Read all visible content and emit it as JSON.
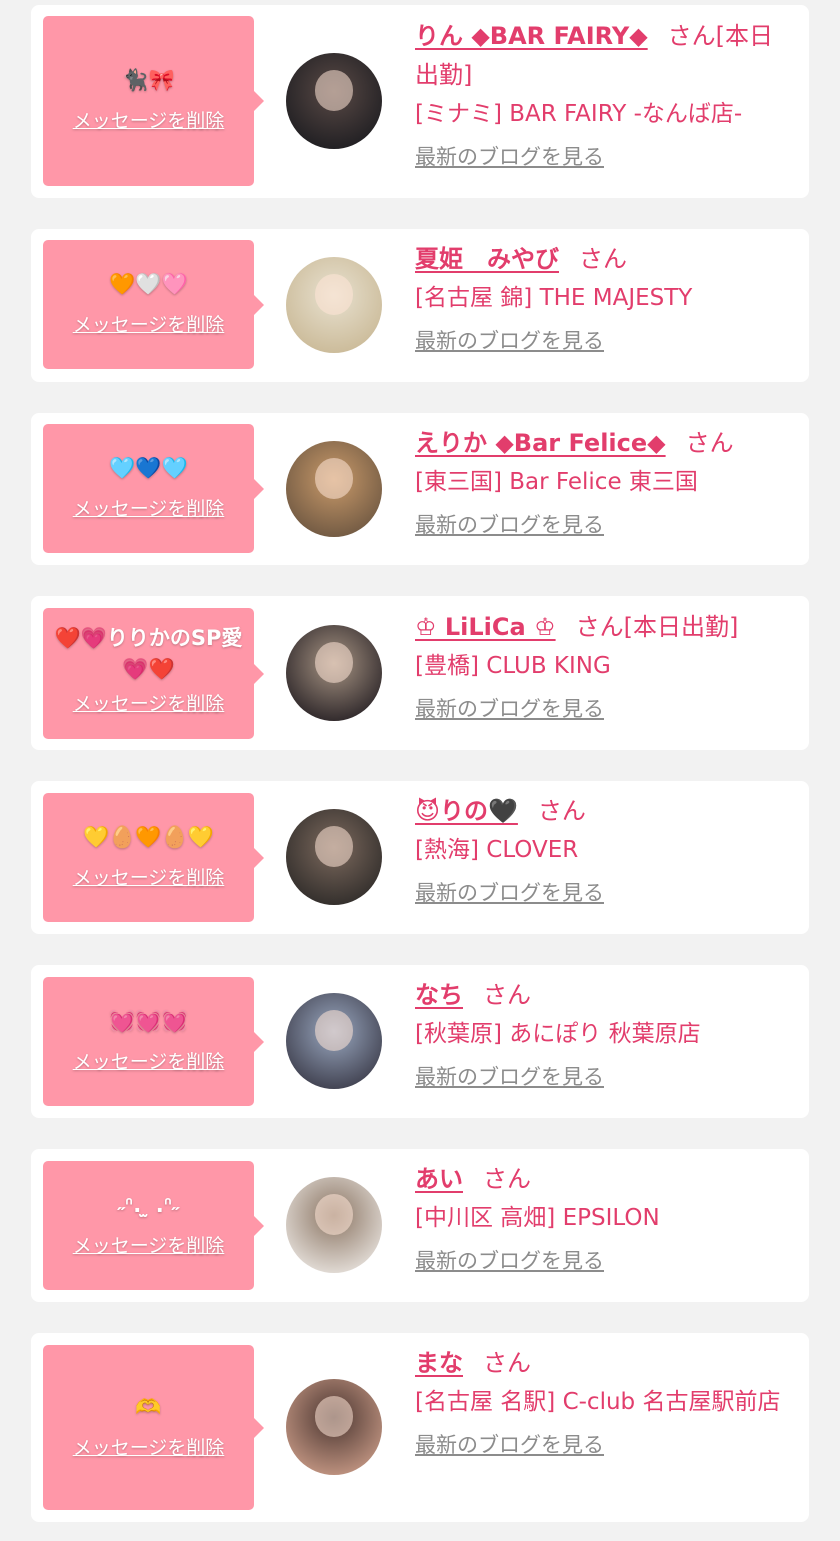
{
  "delete_label": "メッセージを削除",
  "blog_label": "最新のブログを見る",
  "honorific": "さん",
  "colors": {
    "background": "#f2f2f2",
    "card": "#ffffff",
    "message_bubble": "#ff97a8",
    "accent": "#e23d6c",
    "link_gray": "#8c8c8c"
  },
  "cards": [
    {
      "message": "🐈‍⬛🎀",
      "name": "りん ◆BAR FAIRY◆",
      "status": "[本日出勤]",
      "shop": "[ミナミ] BAR FAIRY -なんば店-",
      "avatar_colors": [
        "#1c1c20",
        "#5a4a46"
      ]
    },
    {
      "message": "🧡🤍🩷",
      "name": "夏姫　みやび",
      "status": "",
      "shop": "[名古屋 錦] THE MAJESTY",
      "avatar_colors": [
        "#c9b895",
        "#e8e1d0"
      ]
    },
    {
      "message": "🩵💙🩵",
      "name": "えりか ◆Bar Felice◆",
      "status": "",
      "shop": "[東三国] Bar Felice 東三国",
      "avatar_colors": [
        "#6b5540",
        "#c99a6a"
      ]
    },
    {
      "message": "❤️💗りりかのSP愛💗❤️",
      "name": "♔ LiLiCa ♔",
      "status": "[本日出勤]",
      "shop": "[豊橋] CLUB KING",
      "avatar_colors": [
        "#262024",
        "#a89584"
      ]
    },
    {
      "message": "💛🥚🧡🥚💛",
      "name": "😈りの🖤",
      "status": "",
      "shop": "[熱海] CLOVER",
      "avatar_colors": [
        "#2d2a28",
        "#7d6a5e"
      ]
    },
    {
      "message": "💓💓💓",
      "name": "なち",
      "status": "",
      "shop": "[秋葉原] あにぽり 秋葉原店",
      "avatar_colors": [
        "#3a3a48",
        "#9aa8c0"
      ]
    },
    {
      "message": "˶ᐢ. ̫ .ᐢ˶",
      "name": "あい",
      "status": "",
      "shop": "[中川区 高畑] EPSILON",
      "avatar_colors": [
        "#e9e4df",
        "#8a7462"
      ]
    },
    {
      "message": "🫶",
      "name": "まな",
      "status": "",
      "shop": "[名古屋 名駅] C-club 名古屋駅前店",
      "avatar_colors": [
        "#c89a86",
        "#4a3530"
      ]
    }
  ]
}
